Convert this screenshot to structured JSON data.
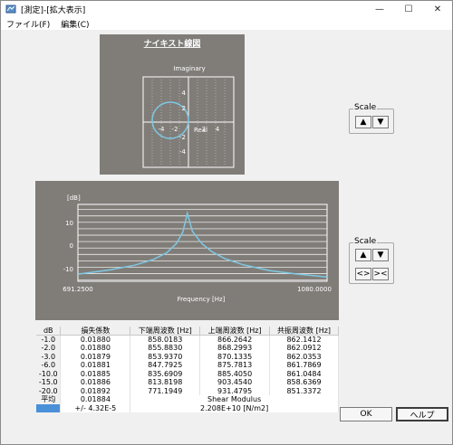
{
  "window": {
    "title": "[測定]-[拡大表示]",
    "controls": [
      "—",
      "☐",
      "✕"
    ]
  },
  "menu": [
    "ファイル(F)",
    "編集(C)"
  ],
  "nyquist": {
    "title": "ナイキスト線図",
    "imag_label": "Imaginary",
    "real_label": "Real",
    "x_ticks": [
      "-4",
      "-2",
      "2",
      "4"
    ],
    "y_ticks": [
      "4",
      "2",
      "-2",
      "-4"
    ]
  },
  "scale1": {
    "legend": "Scale",
    "up": "▲",
    "down": "▼"
  },
  "freq": {
    "unit": "[dB]",
    "y_ticks": [
      "10",
      "0",
      "-10"
    ],
    "x_min": "691.2500",
    "x_max": "1080.0000",
    "xlabel": "Frequency [Hz]"
  },
  "scale2": {
    "legend": "Scale",
    "up": "▲",
    "down": "▼",
    "expand": "<>",
    "shrink": "><"
  },
  "chart_data": [
    {
      "type": "scatter",
      "title": "ナイキスト線図",
      "xlabel": "Real",
      "ylabel": "Imaginary",
      "xlim": [
        -5,
        5
      ],
      "ylim": [
        -5,
        5
      ],
      "grid": true,
      "series": [
        {
          "name": "",
          "shape": "circle",
          "center": [
            -2.0,
            0.2
          ],
          "radius": 2.0
        }
      ]
    },
    {
      "type": "line",
      "title": "",
      "xlabel": "Frequency [Hz]",
      "ylabel": "[dB]",
      "xlim": [
        691.25,
        1080.0
      ],
      "ylim": [
        -13,
        17
      ],
      "grid": true,
      "series": [
        {
          "name": "",
          "x": [
            691.25,
            740,
            780,
            810,
            830,
            845,
            855,
            862,
            870,
            885,
            900,
            920,
            950,
            990,
            1030,
            1080
          ],
          "y": [
            -10.2,
            -8.6,
            -6.7,
            -4.4,
            -1.8,
            1.8,
            6.2,
            13.5,
            6.5,
            1.6,
            -1.4,
            -4.1,
            -6.6,
            -8.8,
            -10.1,
            -11.3
          ]
        }
      ]
    }
  ],
  "table": {
    "headers": [
      "dB",
      "損失係数",
      "下端周波数 [Hz]",
      "上端周波数 [Hz]",
      "共振周波数 [Hz]"
    ],
    "rows": [
      [
        "-1.0",
        "0.01880",
        "858.0183",
        "866.2642",
        "862.1412"
      ],
      [
        "-2.0",
        "0.01880",
        "855.8830",
        "868.2993",
        "862.0912"
      ],
      [
        "-3.0",
        "0.01879",
        "853.9370",
        "870.1335",
        "862.0353"
      ],
      [
        "-6.0",
        "0.01881",
        "847.7925",
        "875.7813",
        "861.7869"
      ],
      [
        "-10.0",
        "0.01885",
        "835.6909",
        "885.4050",
        "861.0484"
      ],
      [
        "-15.0",
        "0.01886",
        "813.8198",
        "903.4540",
        "858.6369"
      ],
      [
        "-20.0",
        "0.01892",
        "771.1949",
        "931.4795",
        "851.3372"
      ]
    ],
    "avg_label": "平均",
    "avg_loss": "0.01884",
    "shear_label": "Shear Modulus",
    "dev": "+/- 4.32E-5",
    "shear_value": "2.208E+10 [N/m2]"
  },
  "buttons": {
    "ok": "OK",
    "help": "ヘルプ"
  }
}
